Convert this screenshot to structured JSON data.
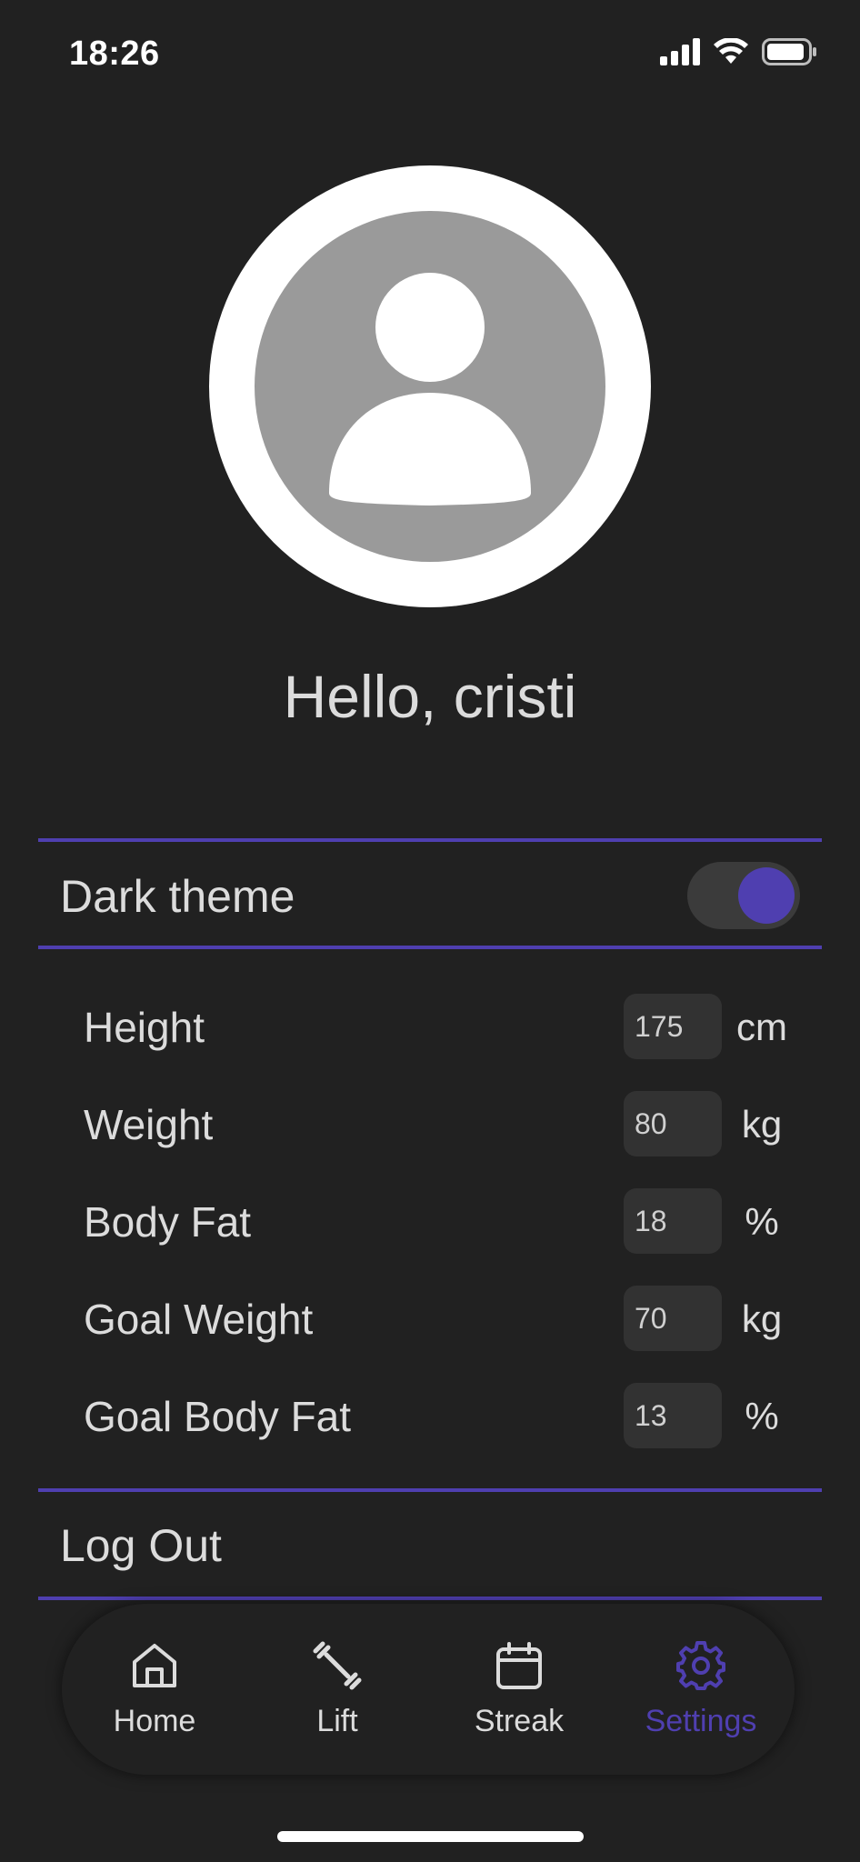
{
  "status_bar": {
    "time": "18:26",
    "icons": [
      "signal-icon",
      "wifi-icon",
      "battery-icon"
    ]
  },
  "profile": {
    "avatar_icon": "user-icon",
    "greeting": "Hello, cristi"
  },
  "settings": {
    "dark_theme_label": "Dark theme",
    "dark_theme_enabled": true,
    "stats": [
      {
        "label": "Height",
        "value": "175",
        "unit": "cm"
      },
      {
        "label": "Weight",
        "value": "80",
        "unit": "kg"
      },
      {
        "label": "Body Fat",
        "value": "18",
        "unit": "%"
      },
      {
        "label": "Goal Weight",
        "value": "70",
        "unit": "kg"
      },
      {
        "label": "Goal Body Fat",
        "value": "13",
        "unit": "%"
      }
    ],
    "logout_label": "Log Out"
  },
  "nav": {
    "items": [
      {
        "label": "Home",
        "icon": "home-icon",
        "active": false
      },
      {
        "label": "Lift",
        "icon": "dumbbell-icon",
        "active": false
      },
      {
        "label": "Streak",
        "icon": "calendar-icon",
        "active": false
      },
      {
        "label": "Settings",
        "icon": "gear-icon",
        "active": true
      }
    ]
  },
  "colors": {
    "background": "#212121",
    "accent": "#4f3fb0",
    "text": "#dcdcdc",
    "input_bg": "#323232"
  }
}
